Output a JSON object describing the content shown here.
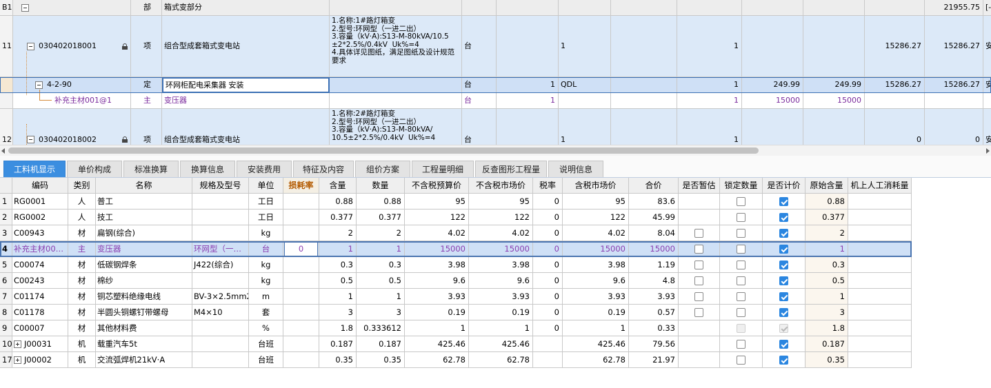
{
  "top_grid": {
    "rows": [
      {
        "id": "section",
        "num": "B1",
        "code": "",
        "type": "部",
        "name": "箱式变部分",
        "feature": "",
        "unit": "",
        "col_a": "",
        "col_b": "",
        "col_c": "",
        "col_d": "",
        "col_e": "",
        "col_f": "",
        "col_g": "",
        "col_h": "21955.75",
        "col_i": "[-"
      },
      {
        "id": "item-11",
        "num": "11",
        "code": "030402018001",
        "type": "项",
        "name": "组合型成套箱式变电站",
        "feature": "1.名称:1#路灯箱变\n2.型号:环网型（一进二出）\n3.容量（kV·A):S13-M-80kVA/10.5±2*2.5%/0.4kV  Uk%=4\n4.具体详见图纸，满足图纸及设计规范要求",
        "unit": "台",
        "col_a": "",
        "col_b": "1",
        "col_c": "",
        "col_d": "1",
        "col_e": "",
        "col_f": "",
        "col_g": "15286.27",
        "col_h": "15286.27",
        "col_i": "安"
      },
      {
        "id": "quota",
        "num": "",
        "code": "4-2-90",
        "type": "定",
        "name": "环网柜配电采集器 安装",
        "feature": "",
        "unit": "台",
        "col_a": "1",
        "col_b": "QDL",
        "col_c": "",
        "col_d": "1",
        "col_e": "249.99",
        "col_f": "249.99",
        "col_g": "15286.27",
        "col_h": "15286.27",
        "col_i": "安"
      },
      {
        "id": "material",
        "num": "",
        "code": "补充主材001@1",
        "type": "主",
        "name": "变压器",
        "feature": "",
        "unit": "台",
        "col_a": "1",
        "col_b": "",
        "col_c": "",
        "col_d": "1",
        "col_e": "15000",
        "col_f": "15000",
        "col_g": "",
        "col_h": "",
        "col_i": ""
      },
      {
        "id": "item-12",
        "num": "12",
        "code": "030402018002",
        "type": "项",
        "name": "组合型成套箱式变电站",
        "feature": "1.名称:2#路灯箱变\n2.型号:环网型（一进二出）\n3.容量（kV·A):S13-M-80kVA/\n10.5±2*2.5%/0.4kV  Uk%=4",
        "unit": "台",
        "col_a": "",
        "col_b": "1",
        "col_c": "",
        "col_d": "1",
        "col_e": "",
        "col_f": "",
        "col_g": "0",
        "col_h": "0",
        "col_i": "安"
      }
    ]
  },
  "tabs": [
    {
      "label": "工料机显示",
      "active": true
    },
    {
      "label": "单价构成"
    },
    {
      "label": "标准换算"
    },
    {
      "label": "换算信息"
    },
    {
      "label": "安装费用"
    },
    {
      "label": "特征及内容"
    },
    {
      "label": "组价方案"
    },
    {
      "label": "工程量明细"
    },
    {
      "label": "反查图形工程量"
    },
    {
      "label": "说明信息"
    }
  ],
  "materials_table": {
    "headers": {
      "code": "编码",
      "category": "类别",
      "name": "名称",
      "spec": "规格及型号",
      "unit": "单位",
      "loss": "损耗率",
      "content": "含量",
      "qty": "数量",
      "budget_price_ex": "不含税预算价",
      "market_price_ex": "不含税市场价",
      "tax_rate": "税率",
      "market_price_in": "含税市场价",
      "total": "合价",
      "provisional": "是否暂估",
      "lock_qty": "锁定数量",
      "priced": "是否计价",
      "orig_content": "原始含量",
      "machine_labor": "机上人工消耗量"
    },
    "rows": [
      {
        "num": "1",
        "code": "RG0001",
        "category": "人",
        "name": "普工",
        "spec": "",
        "unit": "工日",
        "loss": "",
        "content": "0.88",
        "qty": "0.88",
        "budget_price_ex": "95",
        "market_price_ex": "95",
        "tax_rate": "0",
        "market_price_in": "95",
        "total": "83.6",
        "provisional": null,
        "lock_qty": false,
        "priced": true,
        "orig_content": "0.88"
      },
      {
        "num": "2",
        "code": "RG0002",
        "category": "人",
        "name": "技工",
        "spec": "",
        "unit": "工日",
        "loss": "",
        "content": "0.377",
        "qty": "0.377",
        "budget_price_ex": "122",
        "market_price_ex": "122",
        "tax_rate": "0",
        "market_price_in": "122",
        "total": "45.99",
        "provisional": null,
        "lock_qty": false,
        "priced": true,
        "orig_content": "0.377"
      },
      {
        "num": "3",
        "code": "C00943",
        "category": "材",
        "name": "扁钢(综合)",
        "spec": "",
        "unit": "kg",
        "loss": "",
        "content": "2",
        "qty": "2",
        "budget_price_ex": "4.02",
        "market_price_ex": "4.02",
        "tax_rate": "0",
        "market_price_in": "4.02",
        "total": "8.04",
        "provisional": false,
        "lock_qty": false,
        "priced": true,
        "orig_content": "2"
      },
      {
        "num": "4",
        "code": "补充主材00…",
        "category": "主",
        "name": "变压器",
        "spec": "环网型（一…",
        "unit": "台",
        "loss": "0",
        "content": "1",
        "qty": "1",
        "budget_price_ex": "15000",
        "market_price_ex": "15000",
        "tax_rate": "0",
        "market_price_in": "15000",
        "total": "15000",
        "provisional": false,
        "lock_qty": false,
        "priced": true,
        "orig_content": "1",
        "selected": true
      },
      {
        "num": "5",
        "code": "C00074",
        "category": "材",
        "name": "低碳钢焊条",
        "spec": "J422(综合)",
        "unit": "kg",
        "loss": "",
        "content": "0.3",
        "qty": "0.3",
        "budget_price_ex": "3.98",
        "market_price_ex": "3.98",
        "tax_rate": "0",
        "market_price_in": "3.98",
        "total": "1.19",
        "provisional": false,
        "lock_qty": false,
        "priced": true,
        "orig_content": "0.3"
      },
      {
        "num": "6",
        "code": "C00243",
        "category": "材",
        "name": "棉纱",
        "spec": "",
        "unit": "kg",
        "loss": "",
        "content": "0.5",
        "qty": "0.5",
        "budget_price_ex": "9.6",
        "market_price_ex": "9.6",
        "tax_rate": "0",
        "market_price_in": "9.6",
        "total": "4.8",
        "provisional": false,
        "lock_qty": false,
        "priced": true,
        "orig_content": "0.5"
      },
      {
        "num": "7",
        "code": "C01174",
        "category": "材",
        "name": "铜芯塑料绝缘电线",
        "spec": "BV-3×2.5mm2",
        "unit": "m",
        "loss": "",
        "content": "1",
        "qty": "1",
        "budget_price_ex": "3.93",
        "market_price_ex": "3.93",
        "tax_rate": "0",
        "market_price_in": "3.93",
        "total": "3.93",
        "provisional": false,
        "lock_qty": false,
        "priced": true,
        "orig_content": "1"
      },
      {
        "num": "8",
        "code": "C01178",
        "category": "材",
        "name": "半圆头铜螺钉带螺母",
        "spec": "M4×10",
        "unit": "套",
        "loss": "",
        "content": "3",
        "qty": "3",
        "budget_price_ex": "0.19",
        "market_price_ex": "0.19",
        "tax_rate": "0",
        "market_price_in": "0.19",
        "total": "0.57",
        "provisional": false,
        "lock_qty": false,
        "priced": true,
        "orig_content": "3"
      },
      {
        "num": "9",
        "code": "C00007",
        "category": "材",
        "name": "其他材料费",
        "spec": "",
        "unit": "%",
        "loss": "",
        "content": "1.8",
        "qty": "0.333612",
        "budget_price_ex": "1",
        "market_price_ex": "1",
        "tax_rate": "0",
        "market_price_in": "1",
        "total": "0.33",
        "provisional": null,
        "lock_qty": "disabled",
        "priced": "disabled",
        "orig_content": "1.8"
      },
      {
        "num": "10",
        "code": "J00031",
        "category": "机",
        "name": "载重汽车5t",
        "spec": "",
        "unit": "台班",
        "loss": "",
        "content": "0.187",
        "qty": "0.187",
        "budget_price_ex": "425.46",
        "market_price_ex": "425.46",
        "tax_rate": "",
        "market_price_in": "425.46",
        "total": "79.56",
        "provisional": null,
        "lock_qty": false,
        "priced": true,
        "orig_content": "0.187",
        "expandable": true
      },
      {
        "num": "17",
        "code": "J00002",
        "category": "机",
        "name": "交流弧焊机21kV·A",
        "spec": "",
        "unit": "台班",
        "loss": "",
        "content": "0.35",
        "qty": "0.35",
        "budget_price_ex": "62.78",
        "market_price_ex": "62.78",
        "tax_rate": "",
        "market_price_in": "62.78",
        "total": "21.97",
        "provisional": null,
        "lock_qty": false,
        "priced": true,
        "orig_content": "0.35",
        "expandable": true
      }
    ]
  }
}
